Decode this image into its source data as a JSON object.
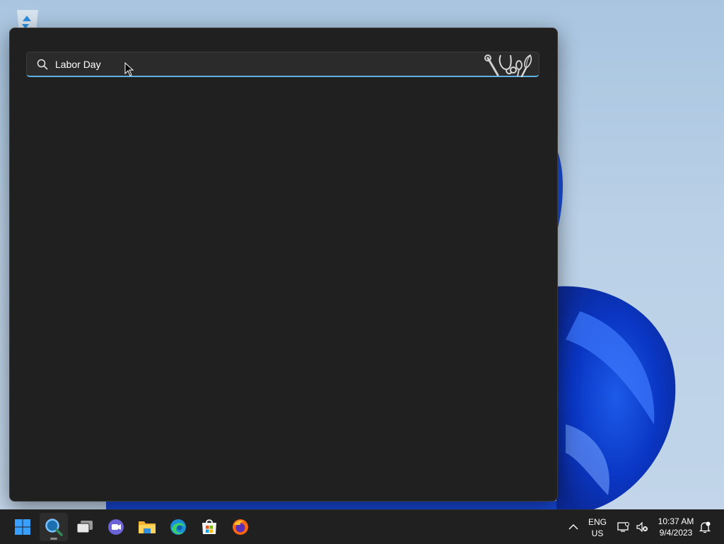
{
  "search": {
    "value": "Labor Day",
    "placeholder": "Labor Day"
  },
  "taskbar": {
    "apps": [
      "start-icon",
      "search-app-icon",
      "task-view-icon",
      "chat-icon",
      "file-explorer-icon",
      "edge-icon",
      "store-icon",
      "firefox-icon"
    ]
  },
  "tray": {
    "language_top": "ENG",
    "language_bottom": "US",
    "time": "10:37 AM",
    "date": "9/4/2023"
  },
  "colors": {
    "window_bg": "#202020",
    "search_accent": "#5db1e4",
    "taskbar_bg": "#202020"
  }
}
